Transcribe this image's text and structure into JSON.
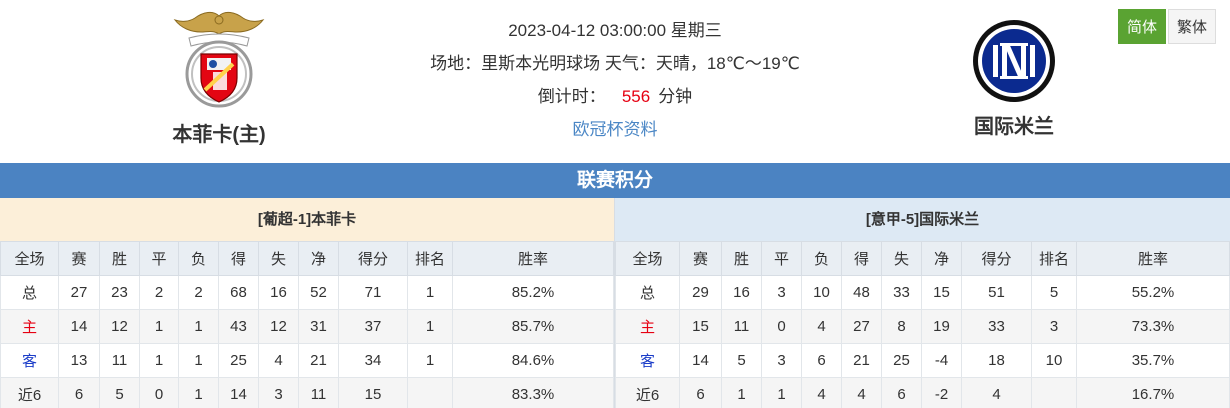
{
  "match": {
    "datetime": "2023-04-12 03:00:00 星期三",
    "venue_weather": "场地：里斯本光明球场 天气：天晴，18℃～19℃",
    "countdown_label": "倒计时：",
    "countdown_value": "556",
    "countdown_unit": "分钟",
    "competition_link": "欧冠杯资料"
  },
  "home_team": {
    "name": "本菲卡(主)",
    "logo_icon": "benfica-crest-icon",
    "color": "#e30613"
  },
  "away_team": {
    "name": "国际米兰",
    "logo_icon": "inter-crest-icon",
    "color": "#0b2a8f"
  },
  "lang": {
    "simplified": "简体",
    "traditional": "繁体"
  },
  "section_title": "联赛积分",
  "standings": {
    "columns": [
      "全场",
      "赛",
      "胜",
      "平",
      "负",
      "得",
      "失",
      "净",
      "得分",
      "排名",
      "胜率"
    ],
    "home": {
      "title": "[葡超-1]本菲卡",
      "rows": [
        [
          "总",
          "27",
          "23",
          "2",
          "2",
          "68",
          "16",
          "52",
          "71",
          "1",
          "85.2%"
        ],
        [
          "主",
          "14",
          "12",
          "1",
          "1",
          "43",
          "12",
          "31",
          "37",
          "1",
          "85.7%"
        ],
        [
          "客",
          "13",
          "11",
          "1",
          "1",
          "25",
          "4",
          "21",
          "34",
          "1",
          "84.6%"
        ],
        [
          "近6",
          "6",
          "5",
          "0",
          "1",
          "14",
          "3",
          "11",
          "15",
          "",
          "83.3%"
        ]
      ]
    },
    "away": {
      "title": "[意甲-5]国际米兰",
      "rows": [
        [
          "总",
          "29",
          "16",
          "3",
          "10",
          "48",
          "33",
          "15",
          "51",
          "5",
          "55.2%"
        ],
        [
          "主",
          "15",
          "11",
          "0",
          "4",
          "27",
          "8",
          "19",
          "33",
          "3",
          "73.3%"
        ],
        [
          "客",
          "14",
          "5",
          "3",
          "6",
          "21",
          "25",
          "-4",
          "18",
          "10",
          "35.7%"
        ],
        [
          "近6",
          "6",
          "1",
          "1",
          "4",
          "4",
          "6",
          "-2",
          "4",
          "",
          "16.7%"
        ]
      ]
    }
  }
}
